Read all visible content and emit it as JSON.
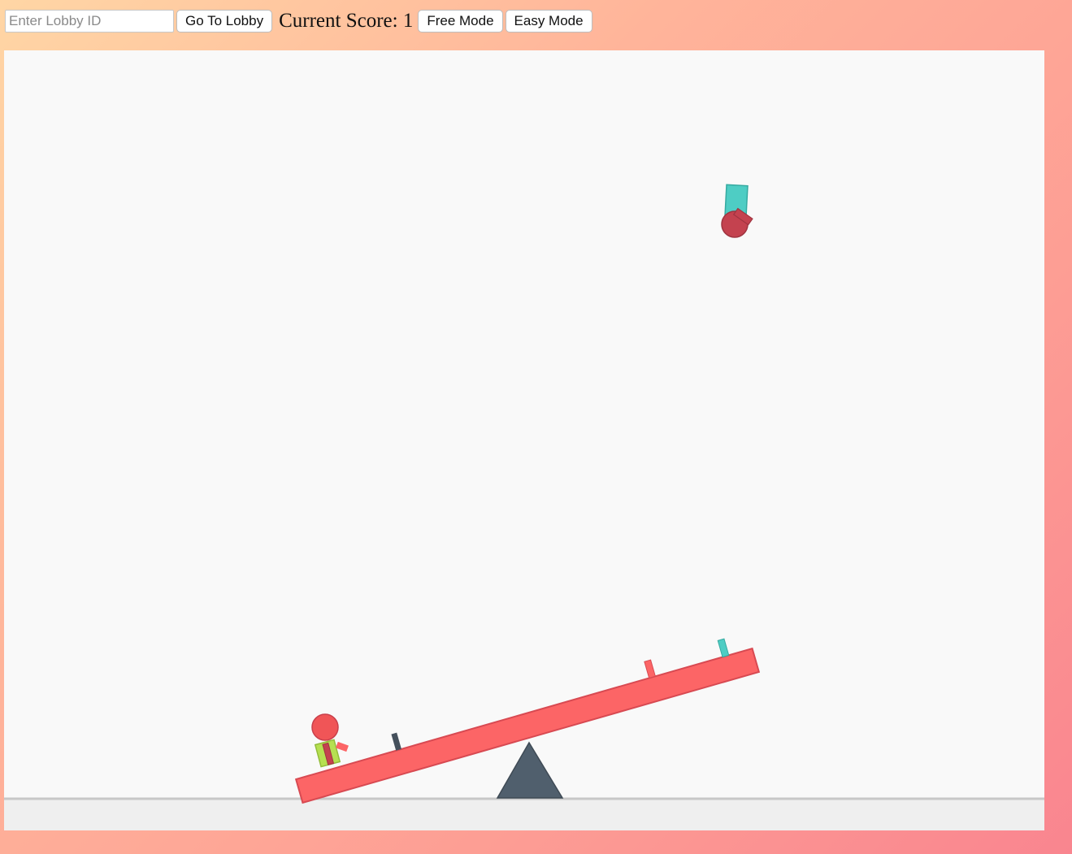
{
  "toolbar": {
    "lobby_placeholder": "Enter Lobby ID",
    "lobby_value": "",
    "go_to_lobby_label": "Go To Lobby",
    "score_label": "Current Score: ",
    "score_value": "1",
    "free_mode_label": "Free Mode",
    "easy_mode_label": "Easy Mode"
  },
  "game": {
    "colors": {
      "background": "#f9f9f9",
      "ground": "#efefef",
      "ground_line": "#c8c8c8",
      "seesaw_plank": "#fc6566",
      "seesaw_stroke": "#d84a52",
      "fulcrum": "#505f6d",
      "player_head": "#f05557",
      "player_body": "#b6e051",
      "falling_block": "#4ecdc4",
      "falling_ball": "#c4424f",
      "peg_red": "#fc6566",
      "peg_teal": "#4ecdc4",
      "peg_dark": "#45505c"
    },
    "icons": {
      "player": "ragdoll-player-icon",
      "seesaw": "seesaw-plank-icon",
      "fulcrum": "triangle-fulcrum-icon",
      "falling_object": "falling-hammer-icon"
    }
  }
}
